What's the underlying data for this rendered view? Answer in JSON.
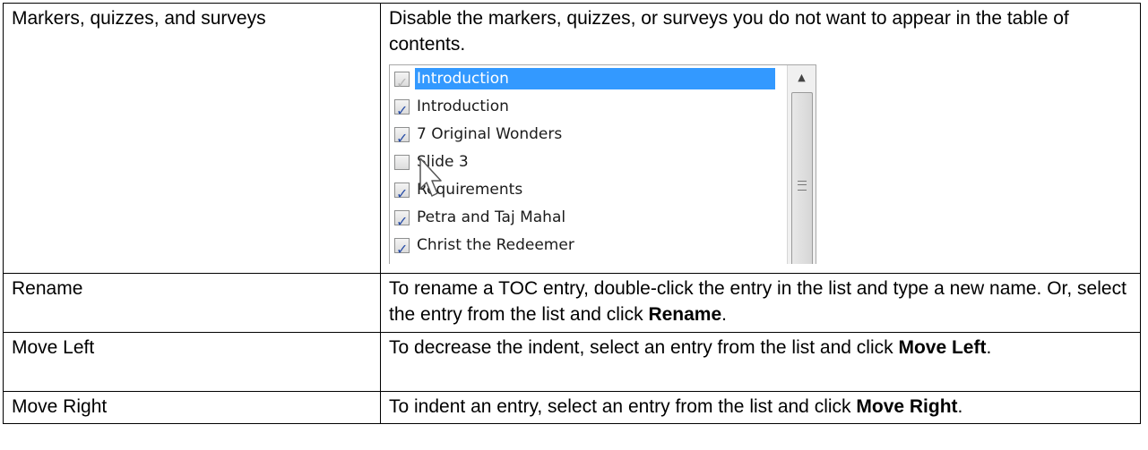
{
  "rows": [
    {
      "term": "Markers, quizzes, and surveys",
      "desc": "Disable the markers, quizzes, or surveys you do not want to appear in the table of contents."
    },
    {
      "term": "Rename",
      "desc_pre": "To rename a TOC entry, double-click the entry in the list and type a new name. Or, select the entry from the list and click ",
      "desc_bold": "Rename",
      "desc_post": "."
    },
    {
      "term": "Move Left",
      "desc_pre": "To decrease the indent, select an entry from the list and click ",
      "desc_bold": "Move Left",
      "desc_post": "."
    },
    {
      "term": "Move Right",
      "desc_pre": "To indent an entry, select an entry from the list and click ",
      "desc_bold": "Move Right",
      "desc_post": "."
    }
  ],
  "toc_list": {
    "items": [
      {
        "label": "Introduction",
        "checked": true,
        "selected": true,
        "disabled": true
      },
      {
        "label": "Introduction",
        "checked": true
      },
      {
        "label": "7 Original Wonders",
        "checked": true
      },
      {
        "label": "Slide 3",
        "checked": false
      },
      {
        "label": "Requirements",
        "checked": true
      },
      {
        "label": "Petra and Taj Mahal",
        "checked": true
      },
      {
        "label": "Christ the Redeemer",
        "checked": true
      }
    ],
    "icons": {
      "scroll_up": "scroll-up-arrow-icon",
      "grip": "scroll-grip-icon",
      "cursor": "mouse-pointer-icon"
    }
  }
}
